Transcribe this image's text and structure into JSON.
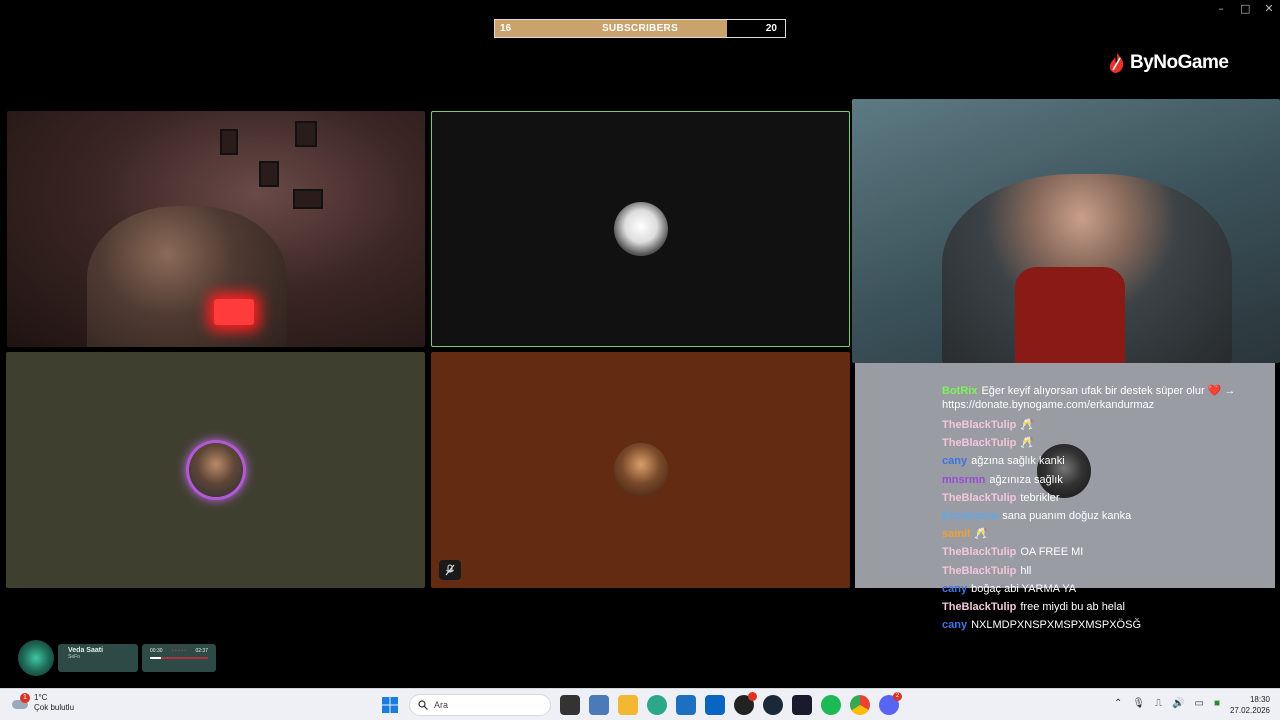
{
  "window_controls": {
    "minimize": "–",
    "maximize": "□",
    "close": "✕"
  },
  "subscribers": {
    "label": "SUBSCRIBERS",
    "current": "16",
    "goal": "20",
    "progress_fraction": 0.8
  },
  "logo": {
    "text": "ByNoGame"
  },
  "tiles": {
    "muted_icon": "mic-off-icon"
  },
  "chat": {
    "messages": [
      {
        "user": "BotRix",
        "color": "#7cf55a",
        "text": "Eğer keyif alıyorsan ufak bir destek süper olur ❤️ → https://donate.bynogame.com/erkandurmaz"
      },
      {
        "user": "TheBlackTulip",
        "color": "#f3c6d8",
        "text": "🥂"
      },
      {
        "user": "TheBlackTulip",
        "color": "#f3c6d8",
        "text": "🥂"
      },
      {
        "user": "cany",
        "color": "#3d74e0",
        "text": "ağzına sağlık kanki"
      },
      {
        "user": "mnsrmn",
        "color": "#9a4bd6",
        "text": "ağzınıza sağlık"
      },
      {
        "user": "TheBlackTulip",
        "color": "#f3c6d8",
        "text": "tebrikler"
      },
      {
        "user": "Eccohomo",
        "color": "#5ea8ee",
        "text": "sana puanım doğuz kanka"
      },
      {
        "user": "samil",
        "color": "#f0a030",
        "text": "🥂"
      },
      {
        "user": "TheBlackTulip",
        "color": "#f3c6d8",
        "text": "OA FREE MI"
      },
      {
        "user": "TheBlackTulip",
        "color": "#f3c6d8",
        "text": "hll"
      },
      {
        "user": "cany",
        "color": "#3d74e0",
        "text": "boğaç abi YARMA YA"
      },
      {
        "user": "TheBlackTulip",
        "color": "#f3c6d8",
        "text": "free miydi bu ab helal"
      },
      {
        "user": "cany",
        "color": "#3d74e0",
        "text": "NXLMDPXNSPXMSPXMSPXÖSĞ"
      }
    ]
  },
  "media": {
    "title": "Veda Saati",
    "artist": "SeFo",
    "elapsed": "00:30",
    "dots": "• • • • •",
    "total": "02:37",
    "progress_fraction": 0.19
  },
  "taskbar": {
    "weather_temp": "1°C",
    "weather_desc": "Çok bulutlu",
    "weather_badge": "1",
    "search_placeholder": "Ara",
    "discord_badge": "2",
    "clock_time": "18:30",
    "clock_date": "27.02.2026",
    "apps": [
      "windows-start-icon",
      "search-icon",
      "task-view-icon",
      "store-icon",
      "file-explorer-icon",
      "edge-icon",
      "microsoft-store-icon",
      "outlook-icon",
      "obs-icon",
      "steam-icon",
      "app-icon",
      "spotify-icon",
      "chrome-icon",
      "discord-icon"
    ]
  }
}
